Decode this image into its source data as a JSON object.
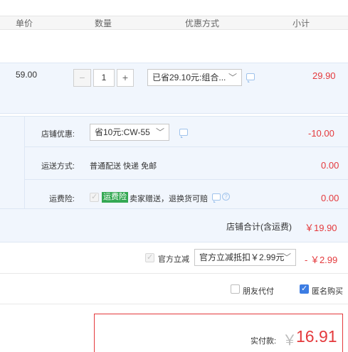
{
  "header": {
    "col_price": "单价",
    "col_qty": "数量",
    "col_discount": "优惠方式",
    "col_subtotal": "小计"
  },
  "item": {
    "price": "59.00",
    "quantity": "1",
    "discount_select": "已省29.10元:组合...",
    "subtotal": "29.90"
  },
  "shop": {
    "coupon_label": "店铺优惠:",
    "coupon_select": "省10元:CW-55",
    "coupon_amount": "-10.00",
    "shipping_label": "运送方式:",
    "shipping_value": "普通配送 快递 免邮",
    "shipping_amount": "0.00",
    "insurance_label": "运费险:",
    "insurance_tag": "运费险",
    "insurance_text": "卖家赠送，退换货可赔",
    "insurance_amount": "0.00",
    "total_label": "店铺合计(含运费)",
    "total_amount": "￥19.90"
  },
  "official": {
    "label": "官方立减",
    "select": "官方立减抵扣￥2.99元",
    "amount": "- ￥2.99"
  },
  "options": {
    "friend_pay": "朋友代付",
    "anonymous": "匿名购买"
  },
  "payment": {
    "label": "实付款:",
    "currency": "￥",
    "amount": "16.91"
  }
}
